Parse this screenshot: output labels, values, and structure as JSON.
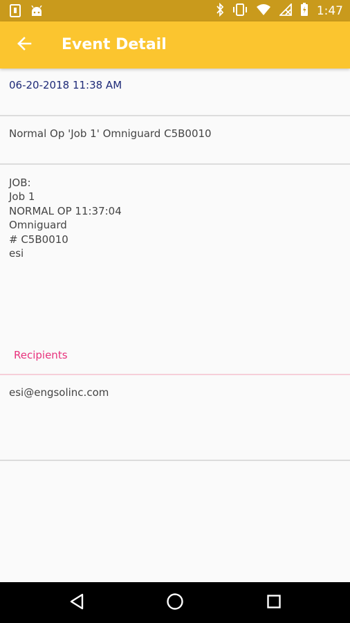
{
  "status_bar": {
    "time": "1:47",
    "left_icons": [
      "sim-card-icon",
      "android-icon"
    ],
    "right_icons": [
      "bluetooth-icon",
      "vibrate-icon",
      "wifi-icon",
      "no-signal-icon",
      "battery-icon"
    ]
  },
  "app_bar": {
    "title": "Event Detail",
    "back_icon": "arrow-back-icon",
    "background": "#fbc52f"
  },
  "event": {
    "datetime": "06-20-2018 11:38 AM",
    "summary": "Normal Op 'Job 1' Omniguard C5B0010",
    "body_lines": [
      "JOB:",
      "Job 1",
      "NORMAL OP 11:37:04",
      "Omniguard",
      "# C5B0010",
      "esi"
    ]
  },
  "recipients": {
    "label": "Recipients",
    "items": [
      "esi@engsolinc.com"
    ],
    "accent": "#e8327c"
  },
  "nav_bar": {
    "buttons": [
      "back-triangle-icon",
      "home-circle-icon",
      "recents-square-icon"
    ]
  }
}
